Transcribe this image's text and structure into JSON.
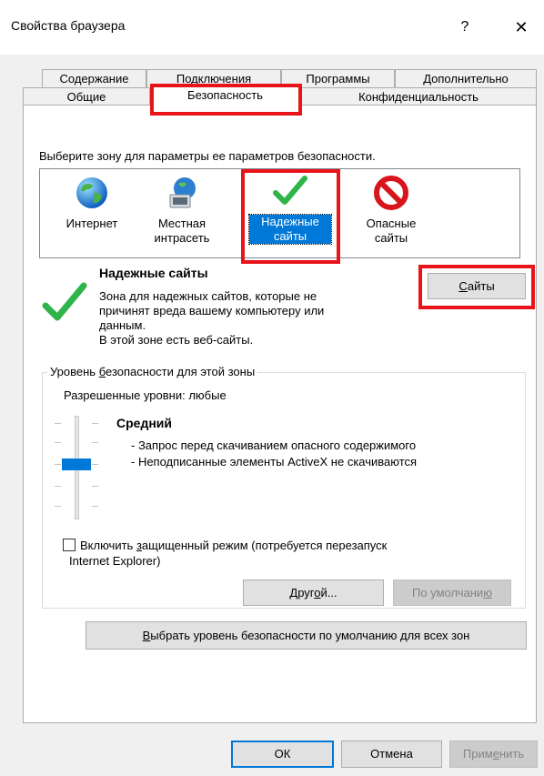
{
  "window": {
    "title": "Свойства браузера",
    "help_label": "?",
    "close_label": "✕"
  },
  "tabs": {
    "row1": [
      "Содержание",
      "Подключения",
      "Программы",
      "Дополнительно"
    ],
    "row2": [
      "Общие",
      "Безопасность",
      "Конфиденциальность"
    ],
    "active": "Безопасность"
  },
  "security": {
    "zone_prompt": "Выберите зону для параметры ее параметров безопасности.",
    "zones": [
      {
        "label": "Интернет",
        "icon": "globe-icon"
      },
      {
        "label": "Местная интрасеть",
        "icon": "intranet-icon"
      },
      {
        "label": "Надежные сайты",
        "icon": "checkmark-icon",
        "selected": true
      },
      {
        "label": "Опасные сайты",
        "icon": "restricted-icon"
      }
    ],
    "selected_zone_title": "Надежные сайты",
    "selected_zone_desc_lines": [
      "Зона для надежных сайтов, которые не",
      "причинят вреда вашему компьютеру или",
      "данным.",
      "В этой зоне есть веб-сайты."
    ],
    "sites_button": {
      "prefix": "",
      "accel": "С",
      "rest": "айты"
    },
    "level_group": {
      "legend_pre": "Уровень ",
      "legend_accel": "б",
      "legend_post": "езопасности для этой зоны",
      "allowed_levels": "Разрешенные уровни: любые",
      "level_name": "Средний",
      "level_desc": [
        "- Запрос перед скачиванием опасного содержимого",
        "- Неподписанные элементы ActiveX не скачиваются"
      ],
      "slider_level": 3,
      "slider_levels_total": 5,
      "protected_mode_pre": "Включить ",
      "protected_mode_accel": "з",
      "protected_mode_post": "ащищенный режим (потребуется перезапуск",
      "protected_mode_line2": "Internet Explorer)",
      "protected_mode_checked": false,
      "custom_button": {
        "pre": "Друг",
        "accel": "о",
        "post": "й..."
      },
      "default_button": {
        "pre": "По умолчани",
        "accel": "ю",
        "post": ""
      }
    },
    "reset_all_button": {
      "pre": "",
      "accel": "В",
      "post": "ыбрать уровень безопасности по умолчанию для всех зон"
    }
  },
  "footer": {
    "ok": "ОК",
    "cancel": "Отмена",
    "apply_pre": "Прим",
    "apply_accel": "е",
    "apply_post": "нить"
  },
  "colors": {
    "highlight": "#e8141a",
    "selection": "#0078d7"
  }
}
